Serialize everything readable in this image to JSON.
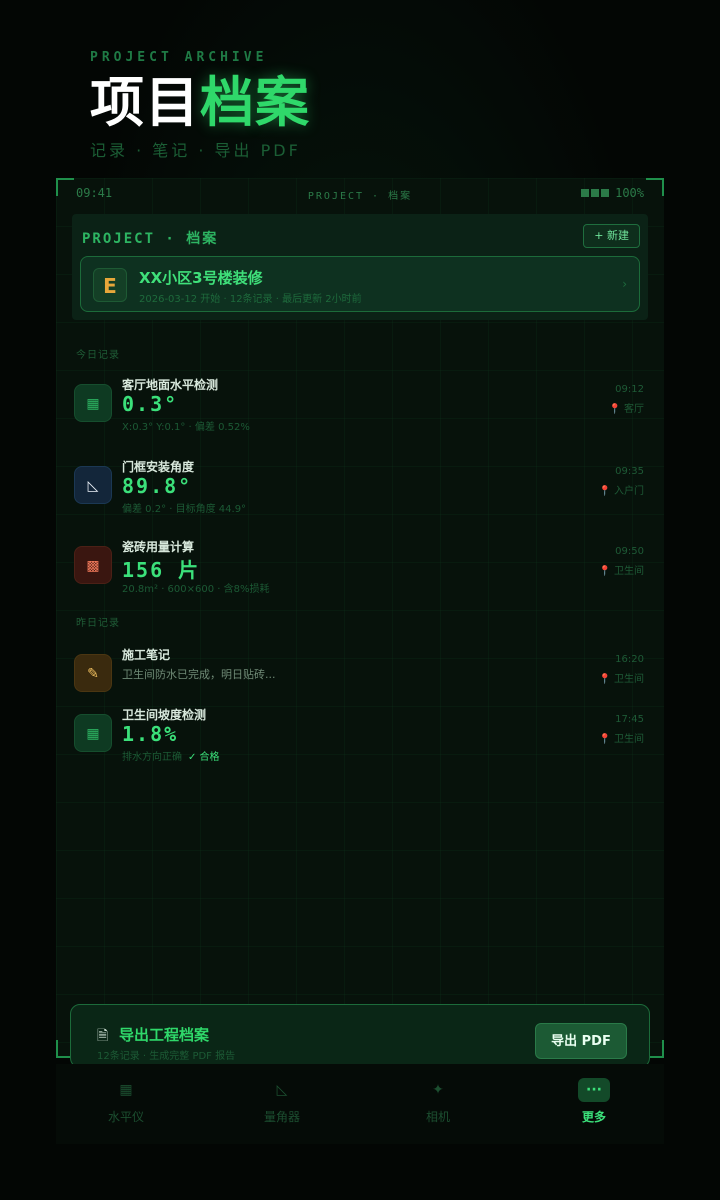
{
  "header": {
    "eyebrow": "PROJECT ARCHIVE",
    "title_white": "项目",
    "title_green": "档案",
    "subtitle": "记录 · 笔记 · 导出 PDF"
  },
  "statusbar": {
    "time": "09:41",
    "center": "PROJECT · 档案",
    "battery": "100%"
  },
  "panel": {
    "label": "PROJECT · 档案",
    "new_button": "+ 新建",
    "project": {
      "icon": "E",
      "name": "XX小区3号楼装修",
      "meta": "2026-03-12 开始 · 12条记录 · 最后更新 2小时前",
      "chevron": "›"
    }
  },
  "sections": {
    "today": "今日记录",
    "yesterday": "昨日记录"
  },
  "records_today": [
    {
      "icon": "level-icon",
      "glyph": "▦",
      "color": "green",
      "title": "客厅地面水平检测",
      "value": "0.3°",
      "sub": "X:0.3° Y:0.1° · 偏差 0.52%",
      "time": "09:12",
      "loc": "客厅"
    },
    {
      "icon": "protractor-icon",
      "glyph": "◺",
      "color": "blue",
      "title": "门框安装角度",
      "value": "89.8°",
      "sub": "偏差 0.2° · 目标角度 44.9°",
      "time": "09:35",
      "loc": "入户门"
    },
    {
      "icon": "tile-icon",
      "glyph": "▩",
      "color": "red",
      "title": "瓷砖用量计算",
      "value": "156 片",
      "sub": "20.8m² · 600×600 · 含8%损耗",
      "time": "09:50",
      "loc": "卫生间"
    }
  ],
  "records_yesterday": [
    {
      "icon": "note-icon",
      "glyph": "✎",
      "color": "amber",
      "title": "施工笔记",
      "note": "卫生间防水已完成，明日贴砖...",
      "time": "16:20",
      "loc": "卫生间"
    },
    {
      "icon": "slope-icon",
      "glyph": "▦",
      "color": "green",
      "title": "卫生间坡度检测",
      "value": "1.8%",
      "sub": "排水方向正确",
      "ok": "✓ 合格",
      "time": "17:45",
      "loc": "卫生间"
    }
  ],
  "export": {
    "title": "导出工程档案",
    "sub": "12条记录 · 生成完整 PDF 报告",
    "button": "导出 PDF"
  },
  "nav": {
    "items": [
      {
        "label": "水平仪",
        "glyph": "▦"
      },
      {
        "label": "量角器",
        "glyph": "◺"
      },
      {
        "label": "相机",
        "glyph": "✦"
      },
      {
        "label": "更多",
        "glyph": "···"
      }
    ],
    "active": 3
  }
}
